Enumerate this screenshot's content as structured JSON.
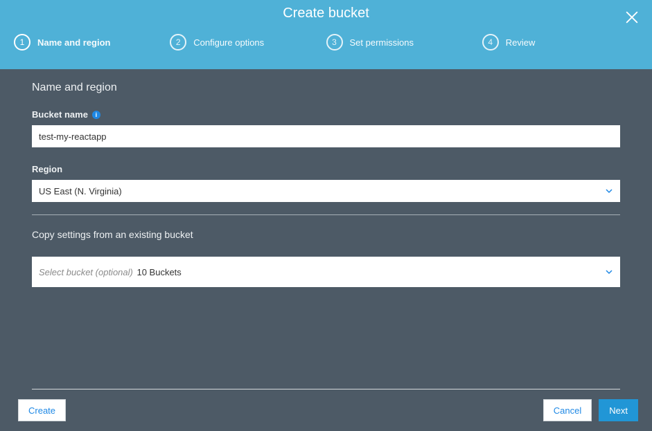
{
  "header": {
    "title": "Create bucket"
  },
  "steps": [
    {
      "num": "1",
      "label": "Name and region",
      "active": true
    },
    {
      "num": "2",
      "label": "Configure options",
      "active": false
    },
    {
      "num": "3",
      "label": "Set permissions",
      "active": false
    },
    {
      "num": "4",
      "label": "Review",
      "active": false
    }
  ],
  "form": {
    "section_title": "Name and region",
    "bucket_name_label": "Bucket name",
    "bucket_name_value": "test-my-reactapp",
    "region_label": "Region",
    "region_value": "US East (N. Virginia)",
    "copy_settings_label": "Copy settings from an existing bucket",
    "copy_settings_placeholder": "Select bucket (optional)",
    "copy_settings_count": "10 Buckets"
  },
  "footer": {
    "create": "Create",
    "cancel": "Cancel",
    "next": "Next"
  }
}
